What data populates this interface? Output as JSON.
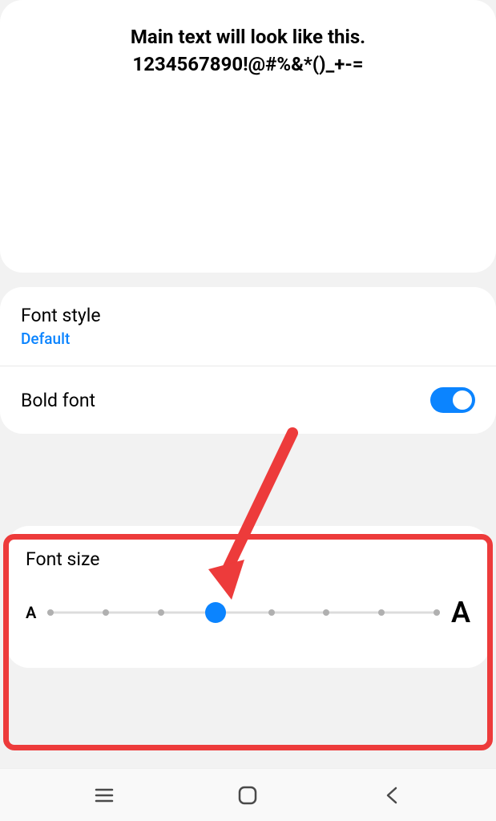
{
  "preview": {
    "line1": "Main text will look like this.",
    "line2": "1234567890!@#%&*()_+-="
  },
  "settings": {
    "fontStyle": {
      "label": "Font style",
      "value": "Default"
    },
    "boldFont": {
      "label": "Bold font",
      "enabled": true
    },
    "fontSize": {
      "label": "Font size",
      "smallIndicator": "A",
      "largeIndicator": "A",
      "steps": 8,
      "currentStep": 4
    }
  },
  "colors": {
    "accent": "#0b84ff",
    "highlight": "#ed3b3b"
  }
}
